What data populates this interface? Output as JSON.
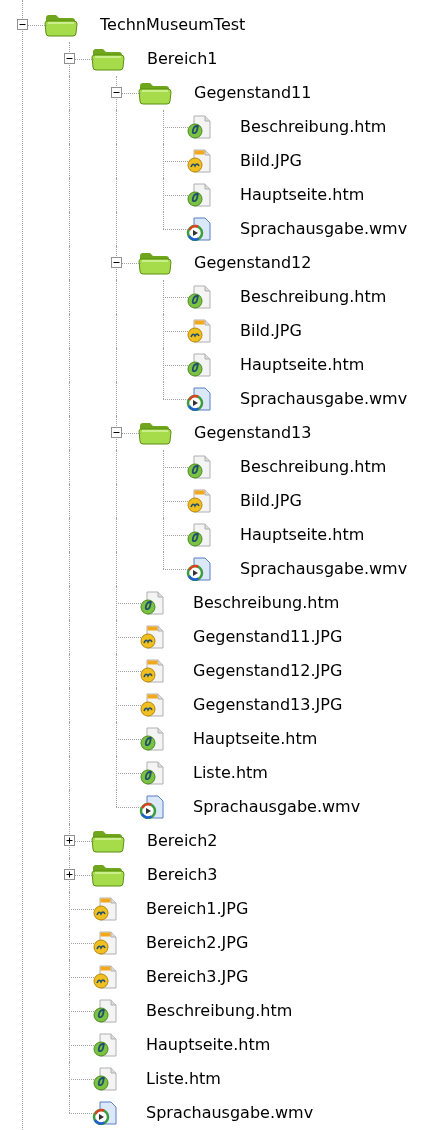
{
  "tree": [
    {
      "name": "TechnMuseumTest",
      "kind": "folder",
      "expanded": true,
      "children": [
        {
          "name": "Bereich1",
          "kind": "folder",
          "expanded": true,
          "children": [
            {
              "name": "Gegenstand11",
              "kind": "folder",
              "expanded": true,
              "children": [
                {
                  "name": "Beschreibung.htm",
                  "kind": "htm"
                },
                {
                  "name": "Bild.JPG",
                  "kind": "jpg"
                },
                {
                  "name": "Hauptseite.htm",
                  "kind": "htm"
                },
                {
                  "name": "Sprachausgabe.wmv",
                  "kind": "wmv"
                }
              ]
            },
            {
              "name": "Gegenstand12",
              "kind": "folder",
              "expanded": true,
              "children": [
                {
                  "name": "Beschreibung.htm",
                  "kind": "htm"
                },
                {
                  "name": "Bild.JPG",
                  "kind": "jpg"
                },
                {
                  "name": "Hauptseite.htm",
                  "kind": "htm"
                },
                {
                  "name": "Sprachausgabe.wmv",
                  "kind": "wmv"
                }
              ]
            },
            {
              "name": "Gegenstand13",
              "kind": "folder",
              "expanded": true,
              "children": [
                {
                  "name": "Beschreibung.htm",
                  "kind": "htm"
                },
                {
                  "name": "Bild.JPG",
                  "kind": "jpg"
                },
                {
                  "name": "Hauptseite.htm",
                  "kind": "htm"
                },
                {
                  "name": "Sprachausgabe.wmv",
                  "kind": "wmv"
                }
              ]
            },
            {
              "name": "Beschreibung.htm",
              "kind": "htm"
            },
            {
              "name": "Gegenstand11.JPG",
              "kind": "jpg"
            },
            {
              "name": "Gegenstand12.JPG",
              "kind": "jpg"
            },
            {
              "name": "Gegenstand13.JPG",
              "kind": "jpg"
            },
            {
              "name": "Hauptseite.htm",
              "kind": "htm"
            },
            {
              "name": "Liste.htm",
              "kind": "htm"
            },
            {
              "name": "Sprachausgabe.wmv",
              "kind": "wmv"
            }
          ]
        },
        {
          "name": "Bereich2",
          "kind": "folder",
          "expanded": false
        },
        {
          "name": "Bereich3",
          "kind": "folder",
          "expanded": false
        },
        {
          "name": "Bereich1.JPG",
          "kind": "jpg"
        },
        {
          "name": "Bereich2.JPG",
          "kind": "jpg"
        },
        {
          "name": "Bereich3.JPG",
          "kind": "jpg"
        },
        {
          "name": "Beschreibung.htm",
          "kind": "htm"
        },
        {
          "name": "Hauptseite.htm",
          "kind": "htm"
        },
        {
          "name": "Liste.htm",
          "kind": "htm"
        },
        {
          "name": "Sprachausgabe.wmv",
          "kind": "wmv"
        }
      ]
    }
  ]
}
